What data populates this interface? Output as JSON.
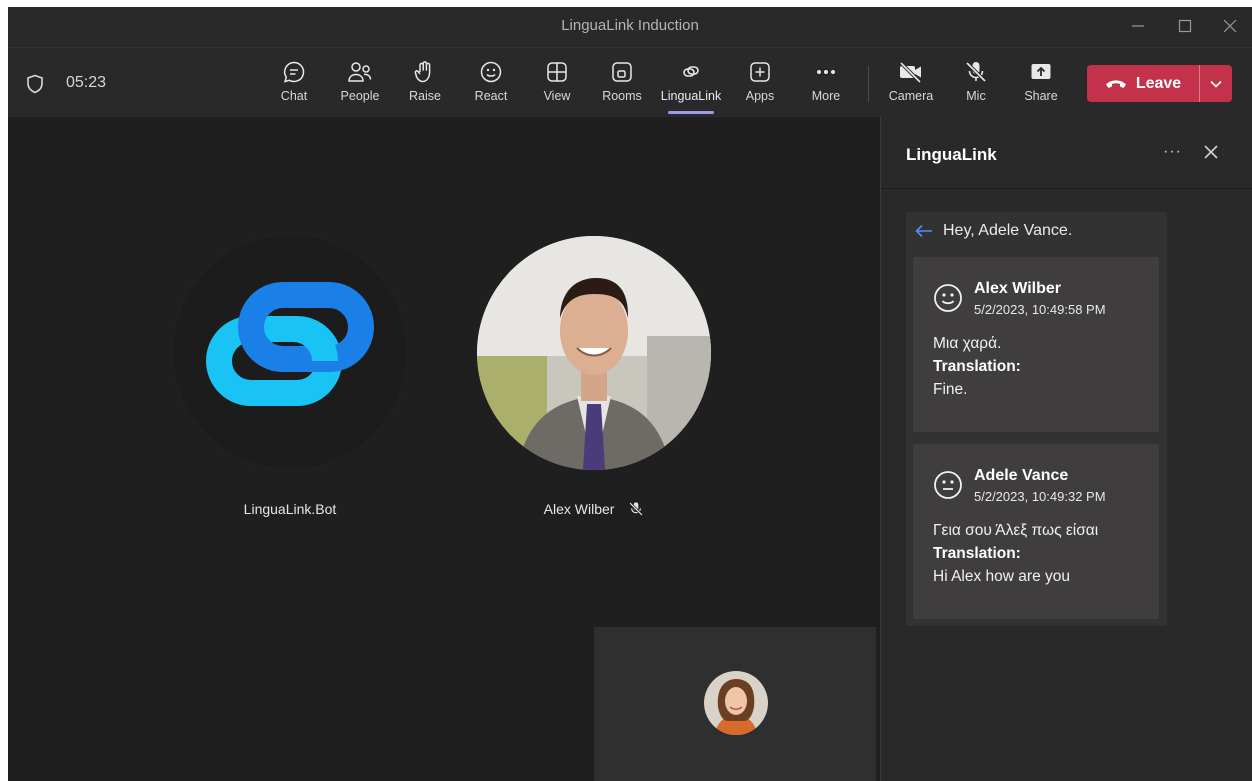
{
  "window": {
    "title": "LinguaLink Induction"
  },
  "toolbar": {
    "timer": "05:23",
    "buttons": {
      "chat": "Chat",
      "people": "People",
      "raise": "Raise",
      "react": "React",
      "view": "View",
      "rooms": "Rooms",
      "lingualink": "LinguaLink",
      "apps": "Apps",
      "more": "More",
      "camera": "Camera",
      "mic": "Mic",
      "share": "Share"
    },
    "leave_label": "Leave",
    "leave_color": "#c4314b",
    "active_accent": "#9b9de8"
  },
  "stage": {
    "participants": [
      {
        "name": "LinguaLink.Bot",
        "icon": "lingualink-logo-icon"
      },
      {
        "name": "Alex Wilber",
        "status_icon": "mic-off-icon"
      }
    ]
  },
  "panel": {
    "title": "LinguaLink",
    "greeting": "Hey, Adele Vance.",
    "messages": [
      {
        "author": "Alex Wilber",
        "time": "5/2/2023, 10:49:58 PM",
        "original": "Μια χαρά.",
        "translation_label": "Translation:",
        "translation": "Fine."
      },
      {
        "author": "Adele Vance",
        "time": "5/2/2023, 10:49:32 PM",
        "original": "Γεια σου Άλεξ πως είσαι",
        "translation_label": "Translation:",
        "translation": "Hi Alex how are you"
      }
    ]
  }
}
